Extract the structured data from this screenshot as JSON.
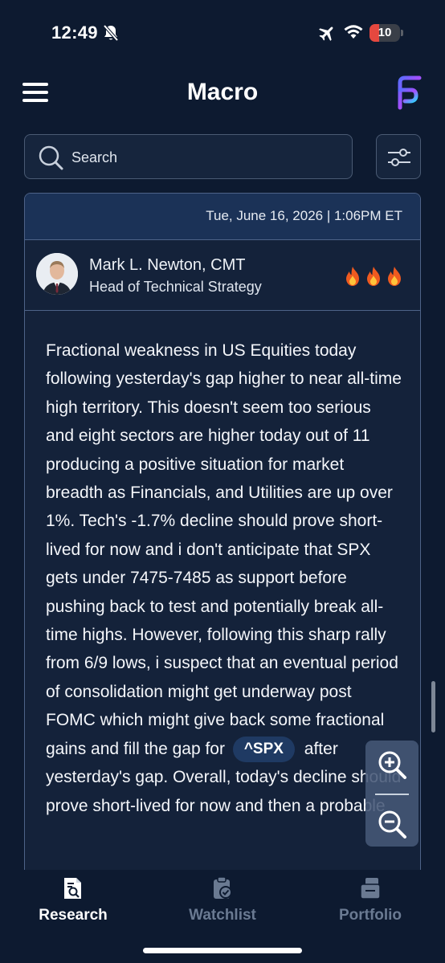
{
  "status_bar": {
    "time": "12:49",
    "battery_level": "10",
    "icons": [
      "bell-off-icon",
      "airplane-icon",
      "wifi-icon",
      "battery-icon"
    ]
  },
  "header": {
    "title": "Macro",
    "menu_icon": "hamburger-menu-icon",
    "logo": "brand-logo"
  },
  "search": {
    "placeholder": "Search",
    "value": ""
  },
  "article": {
    "date": "Tue, June 16, 2026 | 1:06PM ET",
    "author": {
      "name": "Mark L. Newton, CMT",
      "title": "Head of Technical Strategy"
    },
    "rating": 3,
    "rating_icon": "fire-icon",
    "body_before_ticker": "Fractional weakness in US Equities today following yesterday's gap higher to near all-time high territory. This doesn't seem too serious and eight sectors are higher today out of 11 producing a positive situation for market breadth as Financials, and Utilities are up over 1%. Tech's -1.7% decline should prove short-lived for now and i don't anticipate that SPX gets under 7475-7485 as support before pushing back to test and potentially break all-time highs. However, following this sharp rally from 6/9 lows, i suspect that an eventual period of consolidation might get underway post FOMC which might give back some fractional gains and fill the gap for",
    "ticker": "^SPX",
    "body_after_ticker": "after yesterday's gap. Overall, today's decline should prove short-lived for now and then a probable"
  },
  "zoom": {
    "in_icon": "zoom-in-icon",
    "out_icon": "zoom-out-icon"
  },
  "nav": {
    "items": [
      {
        "label": "Research",
        "icon": "research-icon",
        "active": true
      },
      {
        "label": "Watchlist",
        "icon": "watchlist-icon",
        "active": false
      },
      {
        "label": "Portfolio",
        "icon": "portfolio-icon",
        "active": false
      }
    ]
  },
  "colors": {
    "background": "#0d1a30",
    "card": "#14223a",
    "card_header": "#1b3257",
    "border": "#4e6388",
    "ticker_bg": "#1f3a63",
    "battery_low": "#e5483f",
    "inactive_nav": "#6a7a92"
  }
}
